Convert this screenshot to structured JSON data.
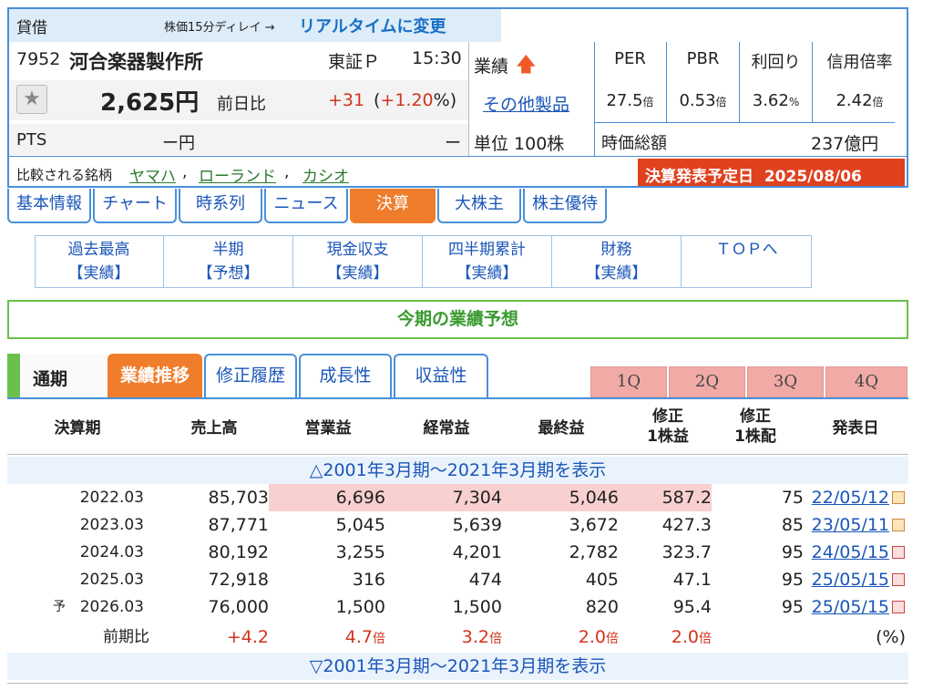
{
  "header": {
    "taishaku": "貸借",
    "delay_text": "株価15分ディレイ →",
    "realtime_link": "リアルタイムに変更",
    "code": "7952",
    "company": "河合楽器製作所",
    "market": "東証Ｐ",
    "time": "15:30",
    "price": "2,625円",
    "zenjitsu_label": "前日比",
    "change": "+31",
    "change_pct_open": "(",
    "change_pct": "+1.20",
    "change_pct_close": "%)",
    "pts_label": "PTS",
    "pts_value": "ー円",
    "pts_dash": "ー",
    "gyoseki_label": "業績",
    "sonota_link": "その他製品",
    "tani": "単位 100株",
    "metrics": [
      {
        "label": "PER",
        "value": "27.5",
        "unit": "倍"
      },
      {
        "label": "PBR",
        "value": "0.53",
        "unit": "倍"
      },
      {
        "label": "利回り",
        "value": "3.62",
        "unit": "%"
      },
      {
        "label": "信用倍率",
        "value": "2.42",
        "unit": "倍"
      }
    ],
    "jika_label": "時価総額",
    "jika_value": "237億円",
    "compare_label": "比較される銘柄",
    "compare": [
      "ヤマハ",
      "ローランド",
      "カシオ"
    ],
    "compare_sep": ",",
    "kessan_label": "決算発表予定日",
    "kessan_date": "2025/08/06"
  },
  "main_tabs": [
    "基本情報",
    "チャート",
    "時系列",
    "ニュース",
    "決算",
    "大株主",
    "株主優待"
  ],
  "sub_nav": [
    {
      "l1": "過去最高",
      "l2": "【実績】"
    },
    {
      "l1": "半期",
      "l2": "【予想】"
    },
    {
      "l1": "現金収支",
      "l2": "【実績】"
    },
    {
      "l1": "四半期累計",
      "l2": "【実績】"
    },
    {
      "l1": "財務",
      "l2": "【実績】"
    },
    {
      "l1": "ＴＯＰへ",
      "l2": ""
    }
  ],
  "section_title": "今期の業績予想",
  "period_label": "通期",
  "sub_tabs": [
    "業績推移",
    "修正履歴",
    "成長性",
    "収益性"
  ],
  "quarters": [
    "1Q",
    "2Q",
    "3Q",
    "4Q"
  ],
  "table": {
    "headers": [
      {
        "l1": "決算期",
        "l2": ""
      },
      {
        "l1": "売上高",
        "l2": ""
      },
      {
        "l1": "営業益",
        "l2": ""
      },
      {
        "l1": "経常益",
        "l2": ""
      },
      {
        "l1": "最終益",
        "l2": ""
      },
      {
        "l1": "修正",
        "l2": "1株益"
      },
      {
        "l1": "修正",
        "l2": "1株配"
      },
      {
        "l1": "発表日",
        "l2": ""
      }
    ],
    "expand_top": "△2001年3月期～2021年3月期を表示",
    "expand_bottom": "▽2001年3月期～2021年3月期を表示",
    "forecast_mark": "予",
    "rows": [
      {
        "period": "2022.03",
        "sales": "85,703",
        "op": "6,696",
        "ord": "7,304",
        "net": "5,046",
        "eps": "587.2",
        "div": "75",
        "date": "22/05/12",
        "icon": "doc-icon"
      },
      {
        "period": "2023.03",
        "sales": "87,771",
        "op": "5,045",
        "ord": "5,639",
        "net": "3,672",
        "eps": "427.3",
        "div": "85",
        "date": "23/05/11",
        "icon": "doc-icon"
      },
      {
        "period": "2024.03",
        "sales": "80,192",
        "op": "3,255",
        "ord": "4,201",
        "net": "2,782",
        "eps": "323.7",
        "div": "95",
        "date": "24/05/15",
        "icon": "pdf-icon"
      },
      {
        "period": "2025.03",
        "sales": "72,918",
        "op": "316",
        "ord": "474",
        "net": "405",
        "eps": "47.1",
        "div": "95",
        "date": "25/05/15",
        "icon": "pdf-icon"
      },
      {
        "period": "2026.03",
        "sales": "76,000",
        "op": "1,500",
        "ord": "1,500",
        "net": "820",
        "eps": "95.4",
        "div": "95",
        "date": "25/05/15",
        "icon": "pdf-icon"
      }
    ],
    "yoy": {
      "label": "前期比",
      "sales": "+4.2",
      "op": "4.7",
      "ord": "3.2",
      "net": "2.0",
      "eps": "2.0",
      "unit": "倍",
      "pct": "(%)"
    }
  }
}
